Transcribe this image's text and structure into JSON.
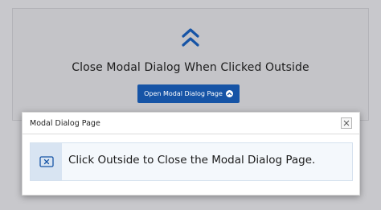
{
  "page": {
    "title": "Close Modal Dialog When Clicked Outside",
    "open_button_label": "Open Modal Dialog Page",
    "open_button_icon": "chevron-up-circle-icon",
    "header_icon": "double-chevron-up-icon"
  },
  "modal": {
    "title": "Modal Dialog Page",
    "close_icon": "close-icon",
    "message": "Click Outside to Close the Modal Dialog Page.",
    "message_icon": "close-box-icon"
  },
  "colors": {
    "accent": "#1654a6",
    "background": "#c8c8cc",
    "message_background": "#f4f8fc",
    "message_icon_background": "#d8e4f2"
  }
}
